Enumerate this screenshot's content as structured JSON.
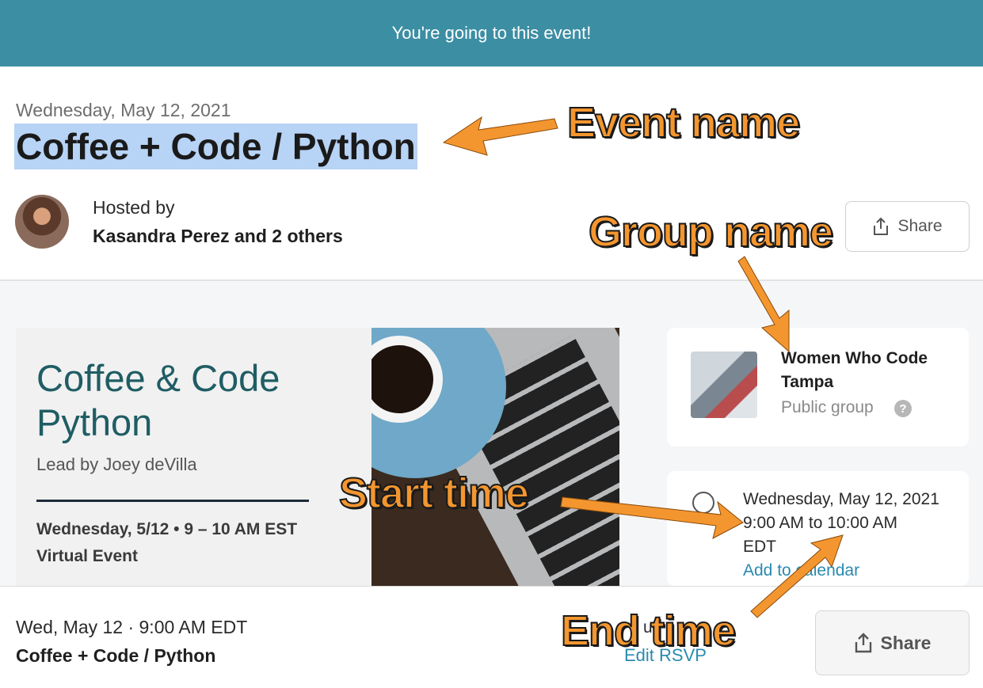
{
  "banner": {
    "text": "You're going to this event!"
  },
  "event": {
    "date": "Wednesday, May 12, 2021",
    "title": "Coffee + Code / Python",
    "hosted_label": "Hosted by",
    "hosts": "Kasandra Perez and 2 others",
    "share_label": "Share"
  },
  "flyer": {
    "title_line1": "Coffee & Code",
    "title_line2": "Python",
    "lead": "Lead by Joey deVilla",
    "when": "Wednesday, 5/12 • 9 – 10 AM EST",
    "where": "Virtual Event"
  },
  "group": {
    "name": "Women Who Code Tampa",
    "type": "Public group",
    "help_icon": "?"
  },
  "time": {
    "date": "Wednesday, May 12, 2021",
    "range": "9:00 AM to 10:00 AM",
    "tz": "EDT",
    "add_calendar": "Add to calendar"
  },
  "footer": {
    "when": "Wed, May 12 · 9:00 AM EDT",
    "title": "Coffee + Code / Python",
    "going": "u",
    "edit_rsvp": "Edit RSVP",
    "share_label": "Share"
  },
  "annotations": {
    "event_name": "Event name",
    "group_name": "Group name",
    "start_time": "Start time",
    "end_time": "End time",
    "color": "#f4962f"
  },
  "icons": [
    "share-icon",
    "clock-icon",
    "help-icon",
    "avatar"
  ],
  "colors": {
    "banner": "#3c8ea3",
    "link": "#2a8ab0",
    "title_highlight": "#b7d3f5"
  }
}
